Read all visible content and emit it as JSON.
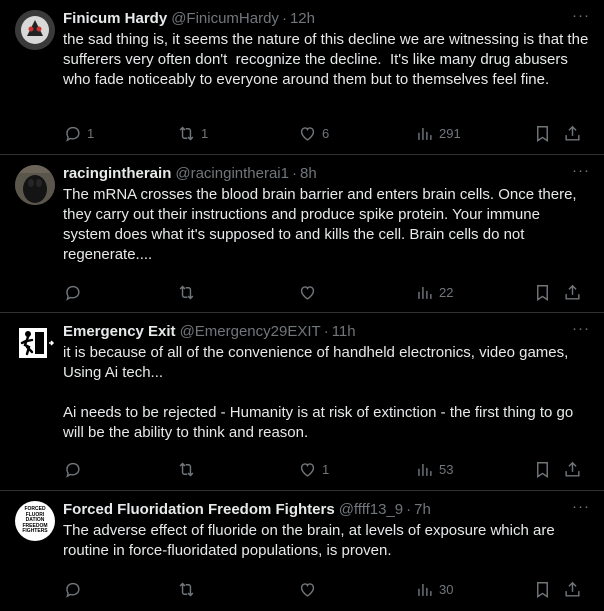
{
  "tweets": [
    {
      "name": "Finicum Hardy",
      "handle": "@FinicumHardy",
      "time": "12h",
      "text": "the sad thing is, it seems the nature of this decline we are witnessing is that the sufferers very often don't  recognize the decline.  It's like many drug abusers who fade noticeably to everyone around them but to themselves feel fine.",
      "replies": "1",
      "retweets": "1",
      "likes": "6",
      "views": "291"
    },
    {
      "name": "racingintherain",
      "handle": "@racingintherai1",
      "time": "8h",
      "text": "The mRNA crosses the blood brain barrier and enters brain cells. Once there, they carry out their instructions and produce spike protein. Your immune system does what it's supposed to and kills the cell. Brain cells do not regenerate....",
      "replies": "",
      "retweets": "",
      "likes": "",
      "views": "22"
    },
    {
      "name": "Emergency Exit",
      "handle": "@Emergency29EXIT",
      "time": "11h",
      "text": "it is because of all of the convenience of handheld electronics, video games, Using Ai tech...\n\nAi needs to be rejected - Humanity is at risk of extinction - the first thing to go will be the ability to think and reason.",
      "replies": "",
      "retweets": "",
      "likes": "1",
      "views": "53"
    },
    {
      "name": "Forced Fluoridation Freedom Fighters",
      "handle": "@ffff13_9",
      "time": "7h",
      "text": "The adverse effect of fluoride on the brain, at levels of exposure which are routine in force-fluoridated populations, is proven.",
      "replies": "",
      "retweets": "",
      "likes": "",
      "views": "30"
    }
  ],
  "avatar_text": {
    "ffff": [
      "FORCED",
      "FLUORI",
      "DATION",
      "FREEDOM",
      "FIGHTERS"
    ]
  },
  "ui": {
    "separator": "·",
    "more": "···"
  },
  "icons": {
    "reply": "reply-icon",
    "retweet": "retweet-icon",
    "like": "heart-icon",
    "views": "views-icon",
    "bookmark": "bookmark-icon",
    "share": "share-icon"
  },
  "colors": {
    "background": "#000000",
    "text": "#e7e9ea",
    "secondary": "#71767b",
    "divider": "#2f3336"
  }
}
